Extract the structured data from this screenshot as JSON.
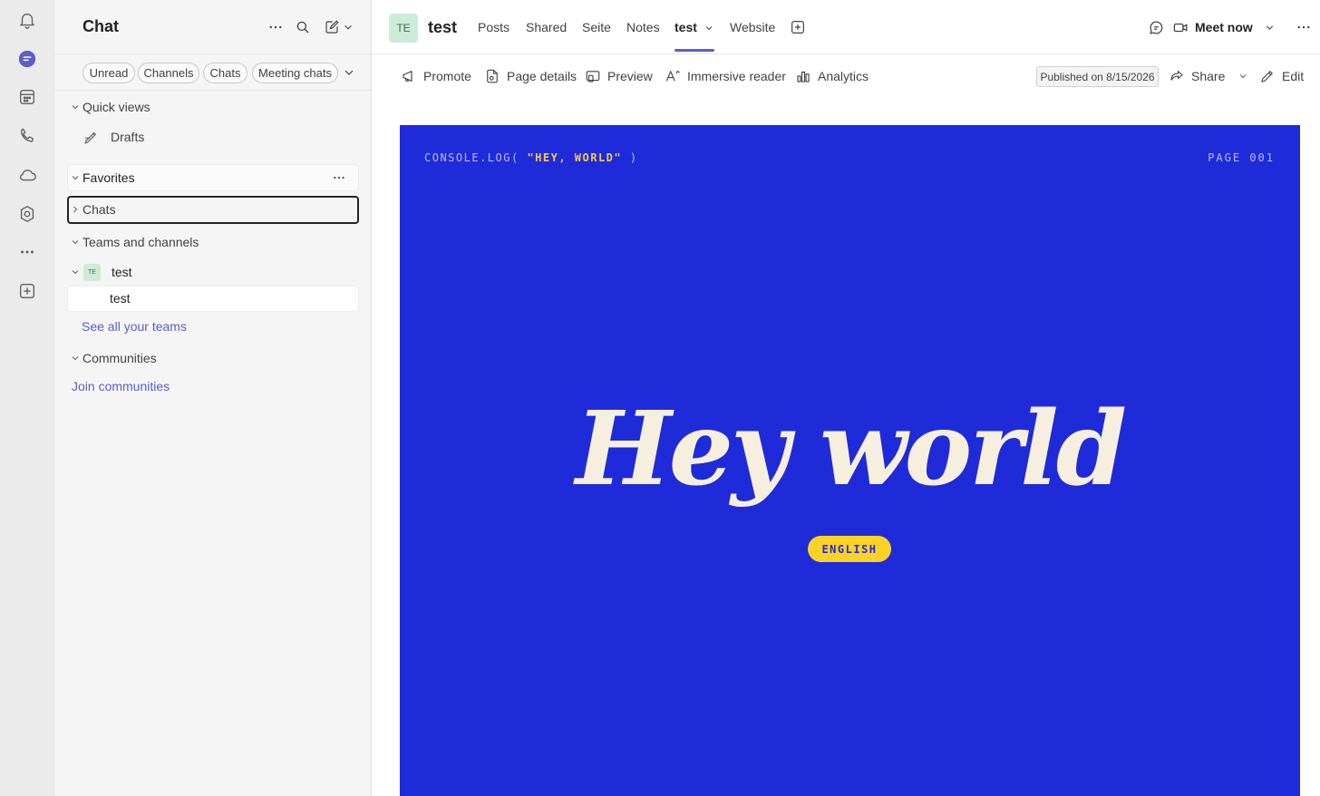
{
  "rail": {
    "items": [
      {
        "name": "activity",
        "icon": "bell-icon"
      },
      {
        "name": "chat",
        "icon": "chat-icon",
        "active": true
      },
      {
        "name": "calendar",
        "icon": "calendar-icon"
      },
      {
        "name": "calls",
        "icon": "phone-icon"
      },
      {
        "name": "onedrive",
        "icon": "cloud-icon"
      },
      {
        "name": "copilot",
        "icon": "copilot-icon"
      },
      {
        "name": "more-apps",
        "icon": "more-icon"
      },
      {
        "name": "add-apps",
        "icon": "add-icon"
      }
    ]
  },
  "left": {
    "title": "Chat",
    "filters": [
      "Unread",
      "Channels",
      "Chats",
      "Meeting chats"
    ],
    "quick_views": {
      "label": "Quick views",
      "drafts": "Drafts"
    },
    "favorites": "Favorites",
    "chats": "Chats",
    "teams_channels": "Teams and channels",
    "team": {
      "initials": "TE",
      "name": "test",
      "channel": "test"
    },
    "see_all_teams": "See all your teams",
    "communities": "Communities",
    "join_communities": "Join communities"
  },
  "main": {
    "team_initials": "TE",
    "team_name": "test",
    "tabs": [
      "Posts",
      "Shared",
      "Seite",
      "Notes",
      "test",
      "Website"
    ],
    "active_tab": "test",
    "meet_now": "Meet now",
    "toolbar": {
      "promote": "Promote",
      "page_details": "Page details",
      "preview": "Preview",
      "immersive_reader": "Immersive reader",
      "analytics": "Analytics",
      "published": "Published on 8/15/2026",
      "share": "Share",
      "edit": "Edit"
    },
    "banner": {
      "console_prefix": "CONSOLE.LOG( ",
      "console_string": "\"HEY, WORLD\"",
      "console_suffix": " )",
      "page": "PAGE 001",
      "headline": "Hey world",
      "language": "ENGLISH",
      "bg_color": "#1f2bd8",
      "accent_color": "#fcd227"
    }
  },
  "colors": {
    "brand": "#5b5fc7",
    "rail_bg": "#ebebeb",
    "pane_bg": "#f5f5f5"
  }
}
